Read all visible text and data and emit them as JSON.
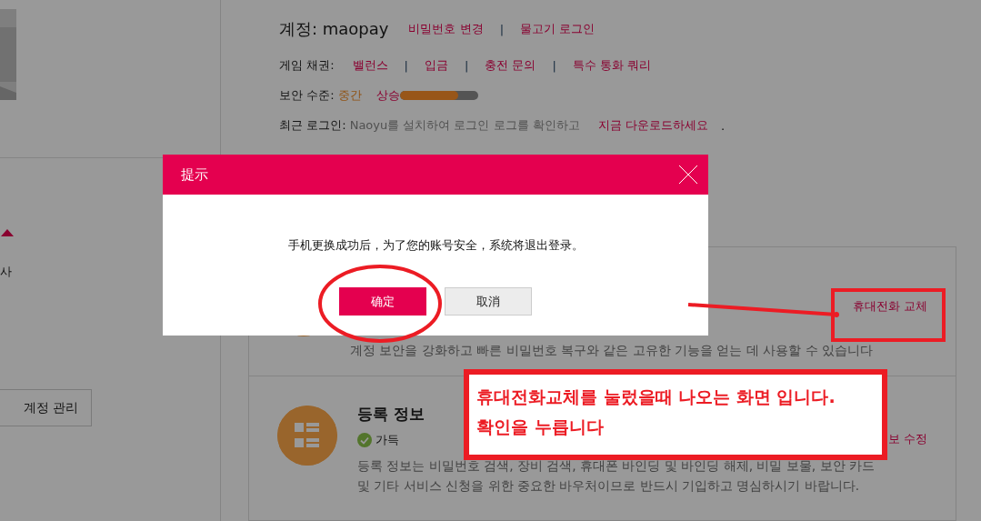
{
  "sidebar": {
    "partial_label": "사",
    "manage_button": "계정 관리"
  },
  "account": {
    "label": "계정: maopay",
    "separator": "|",
    "links": [
      "비밀번호 변경",
      "물고기 로그인"
    ]
  },
  "game_credit": {
    "label": "게임 채권:",
    "separator": "|",
    "links": [
      "밸런스",
      "입금",
      "충전 문의",
      "특수 통화 쿼리"
    ]
  },
  "security": {
    "label": "보안 수준:",
    "value": "중간",
    "upgrade": "상승",
    "level": 0.75
  },
  "recent_login": {
    "label": "최근 로그인:",
    "text": "Naoyu를 설치하여 로그인 로그를 확인하고",
    "link": "지금 다운로드하세요",
    "tail": "."
  },
  "cards": [
    {
      "kind": "phone",
      "action": "휴대전화 교체",
      "description": [
        "계정 보안을 강화하고 빠른 비밀번호 복구와 같은 고유한 기능을 얻는 데 사용할 수 있습니다"
      ]
    },
    {
      "kind": "info",
      "title": "등록 정보",
      "status": "가득",
      "action": "보 수정",
      "description": [
        "등록 정보는 비밀번호 검색, 장비 검색, 휴대폰 바인딩 및 바인딩 해제, 비밀 보물, 보안 카드",
        "및 기타 서비스 신청을 위한 중요한 바우처이므로 반드시 기입하고 명심하시기 바랍니다."
      ]
    }
  ],
  "dialog": {
    "title": "提示",
    "message": "手机更换成功后，为了您的账号安全，系统将退出登录。",
    "buttons": [
      {
        "label": "确定",
        "kind": "primary"
      },
      {
        "label": "取消",
        "kind": "secondary"
      }
    ]
  },
  "annotation": {
    "lines": [
      "휴대전화교체를 눌렀을때 나오는 화면 입니다.",
      "확인을 누릅니다"
    ]
  }
}
